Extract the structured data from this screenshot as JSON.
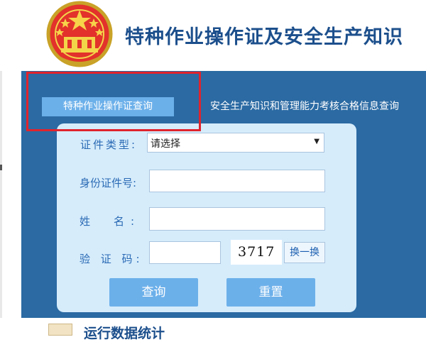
{
  "header": {
    "site_title": "特种作业操作证及安全生产知识"
  },
  "tabs": [
    {
      "label": "特种作业操作证查询",
      "active": true
    },
    {
      "label": "安全生产知识和管理能力考核合格信息查询",
      "active": false
    }
  ],
  "form": {
    "cert_type_label": "证件类型:",
    "cert_type_value": "请选择",
    "id_label": "身份证件号:",
    "name_label": "姓　名:",
    "captcha_label": "验 证 码:",
    "captcha_code": "3717",
    "refresh_label": "换一换",
    "query_button": "查询",
    "reset_button": "重置"
  },
  "bottom": {
    "section_title": "运行数据统计"
  },
  "colors": {
    "header_title": "#1c4f8c",
    "main_bg": "#2b6aa3",
    "tab_active_bg": "#6cb0ea",
    "panel_bg": "#d6ecfb",
    "label_text": "#2a6ab4",
    "button_bg": "#6cb0ea",
    "highlight": "#e0232d"
  }
}
